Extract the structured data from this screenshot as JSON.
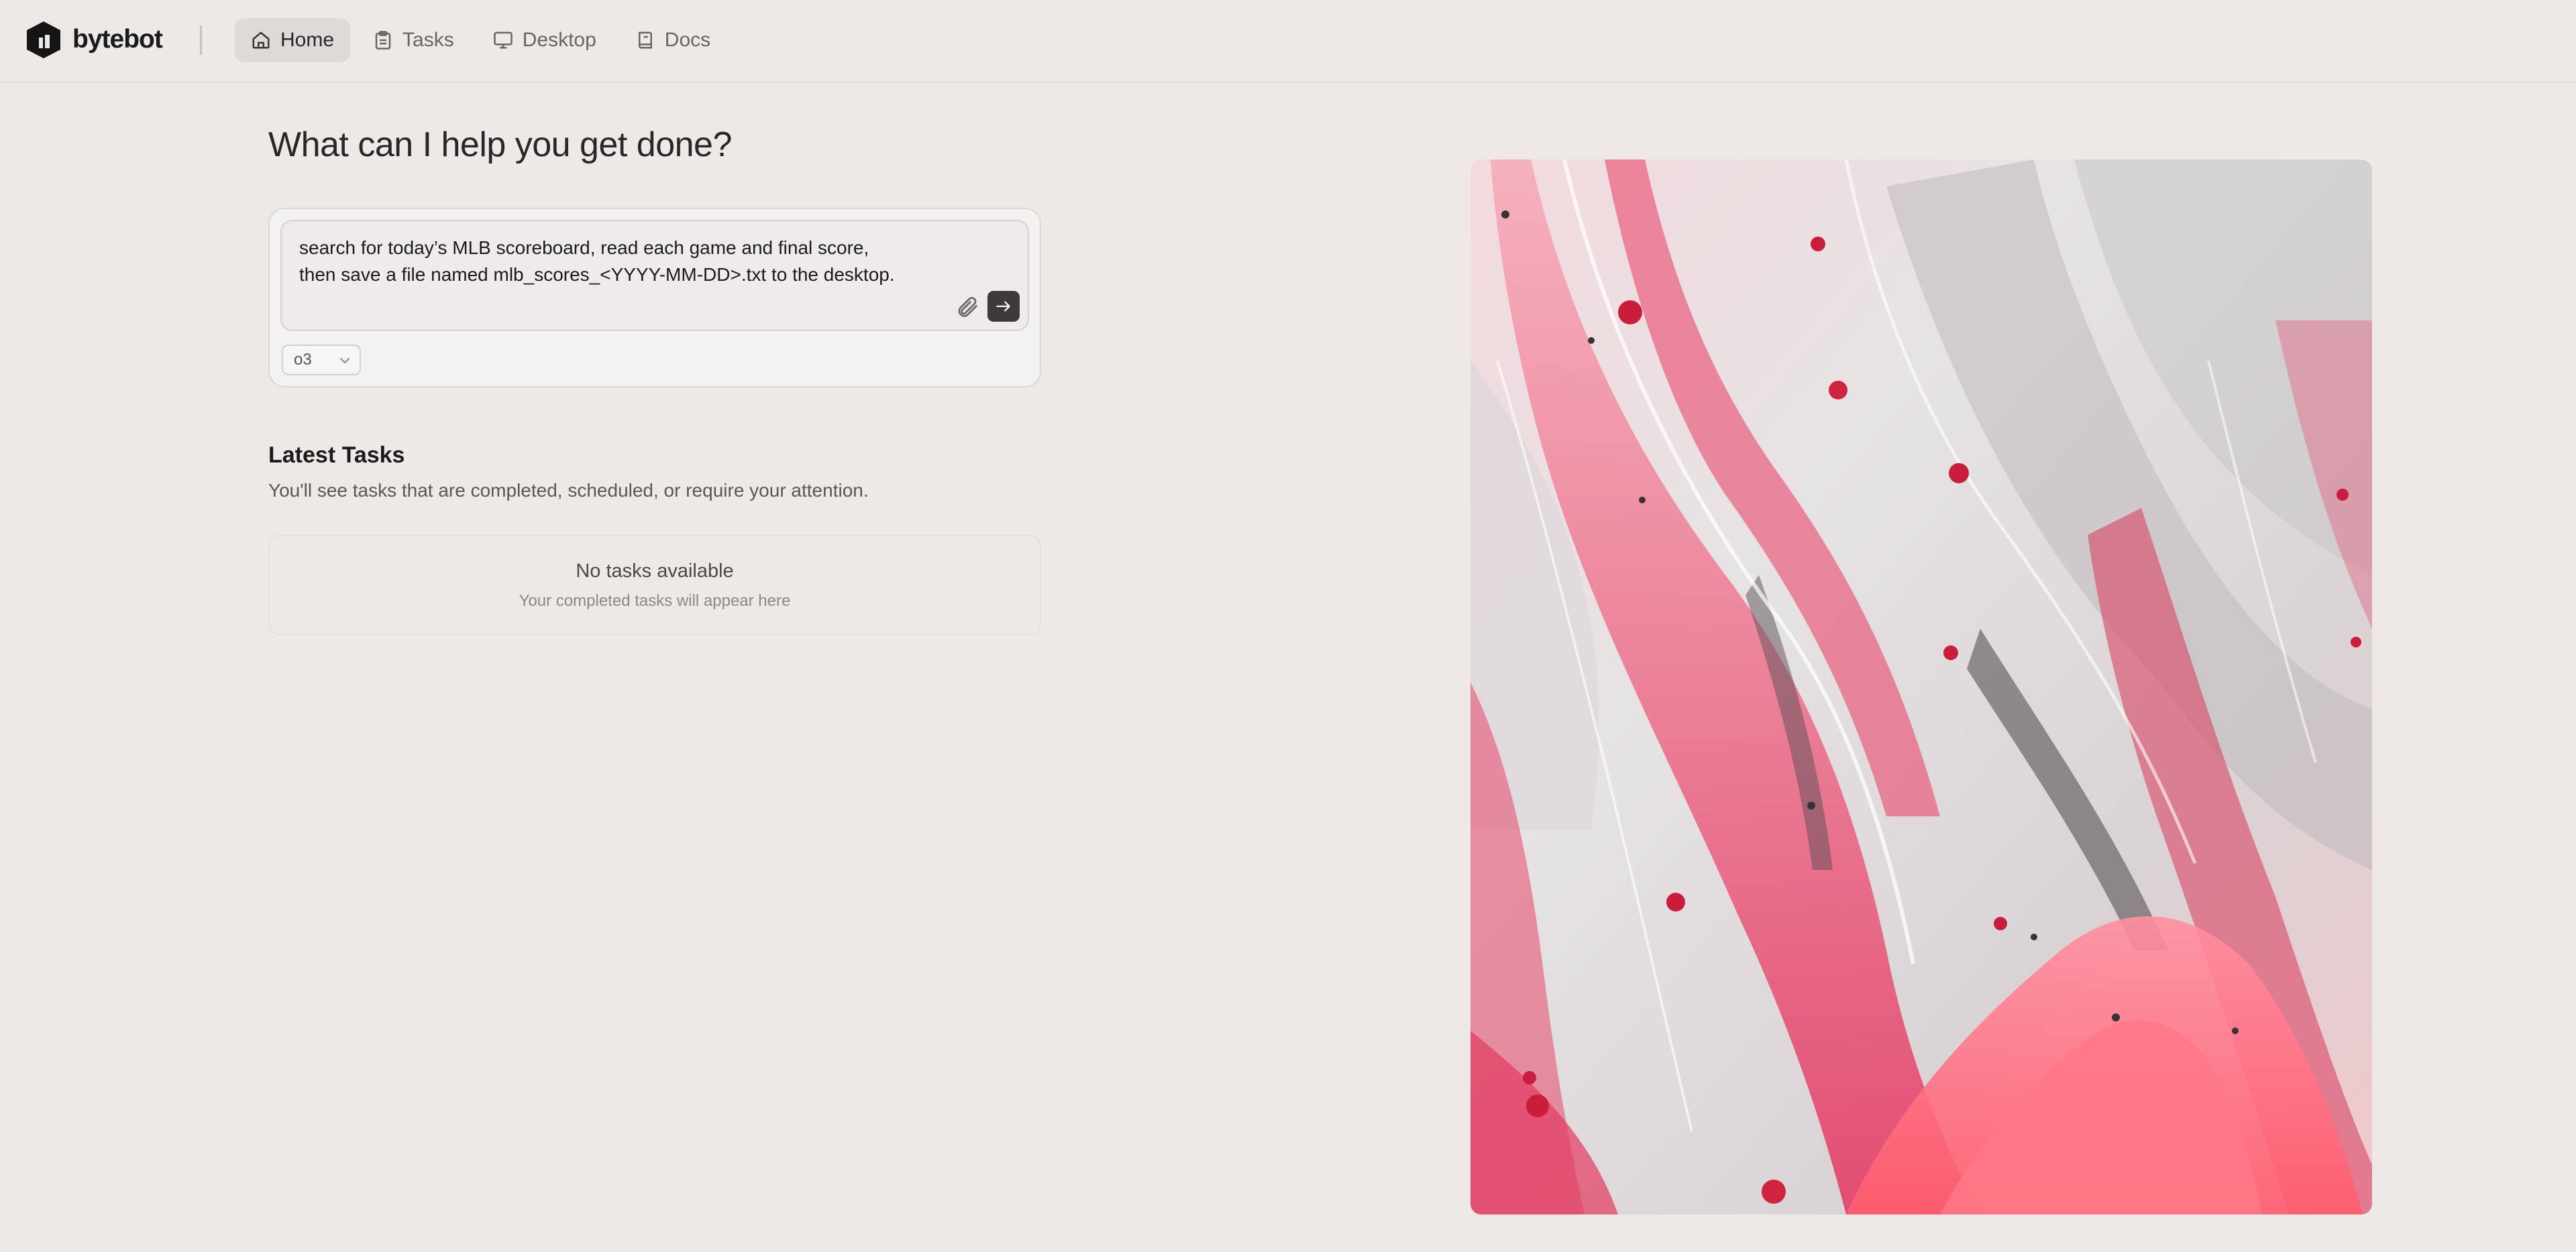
{
  "app": {
    "name": "bytebot"
  },
  "nav": {
    "items": [
      {
        "label": "Home",
        "icon": "home-icon",
        "active": true
      },
      {
        "label": "Tasks",
        "icon": "clipboard-icon",
        "active": false
      },
      {
        "label": "Desktop",
        "icon": "monitor-icon",
        "active": false
      },
      {
        "label": "Docs",
        "icon": "book-icon",
        "active": false
      }
    ]
  },
  "main": {
    "heading": "What can I help you get done?",
    "prompt": {
      "value": "search for today’s MLB scoreboard, read each game and final score,\nthen save a file named mlb_scores_<YYYY-MM-DD>.txt to the desktop.",
      "model": "o3"
    },
    "latest": {
      "title": "Latest Tasks",
      "subtitle": "You'll see tasks that are completed, scheduled, or require your attention.",
      "empty_title": "No tasks available",
      "empty_subtitle": "Your completed tasks will appear here"
    }
  },
  "colors": {
    "background": "#EDE9E7",
    "send_button": "#3F3A3A",
    "nav_active": "#DEDAD8"
  }
}
